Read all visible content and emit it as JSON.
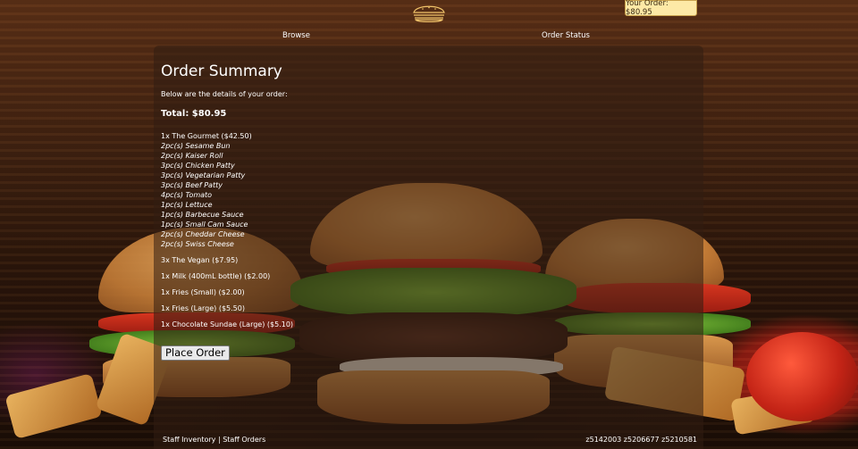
{
  "header": {
    "order_button": "Your Order: $80.95",
    "nav": {
      "browse": "Browse",
      "order_status": "Order Status"
    }
  },
  "summary": {
    "title": "Order Summary",
    "intro": "Below are the details of your order:",
    "total": "Total: $80.95",
    "items": [
      {
        "main": "1x The Gourmet ($42.50)",
        "subs": [
          "2pc(s) Sesame Bun",
          "2pc(s) Kaiser Roll",
          "3pc(s) Chicken Patty",
          "3pc(s) Vegetarian Patty",
          "3pc(s) Beef Patty",
          "4pc(s) Tomato",
          "1pc(s) Lettuce",
          "1pc(s) Barbecue Sauce",
          "1pc(s) Small Cam Sauce",
          "2pc(s) Cheddar Cheese",
          "2pc(s) Swiss Cheese"
        ]
      },
      {
        "main": "3x The Vegan ($7.95)",
        "subs": []
      },
      {
        "main": "1x Milk (400mL bottle) ($2.00)",
        "subs": []
      },
      {
        "main": "1x Fries (Small) ($2.00)",
        "subs": []
      },
      {
        "main": "1x Fries (Large) ($5.50)",
        "subs": []
      },
      {
        "main": "1x Chocolate Sundae (Large) ($5.10)",
        "subs": []
      }
    ],
    "place_order": "Place Order"
  },
  "footer": {
    "staff_inventory": "Staff Inventory",
    "separator": "|",
    "staff_orders": "Staff Orders",
    "ids": "z5142003 z5206677 z5210581"
  }
}
